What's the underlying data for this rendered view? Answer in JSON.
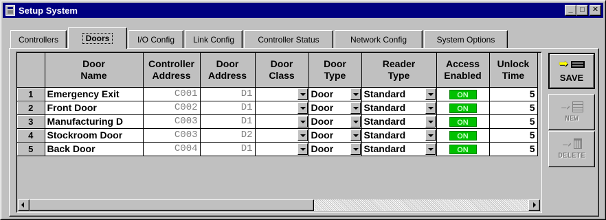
{
  "window": {
    "title": "Setup System"
  },
  "title_buttons": {
    "minimize": "_",
    "maximize": "□",
    "close": "✕"
  },
  "tabs": [
    {
      "label": "Controllers",
      "active": false
    },
    {
      "label": "Doors",
      "active": true
    },
    {
      "label": "I/O Config",
      "active": false
    },
    {
      "label": "Link Config",
      "active": false
    },
    {
      "label": "Controller Status",
      "active": false
    },
    {
      "label": "Network Config",
      "active": false
    },
    {
      "label": "System Options",
      "active": false
    }
  ],
  "grid": {
    "columns": [
      "",
      "Door\nName",
      "Controller\nAddress",
      "Door\nAddress",
      "Door\nClass",
      "Door\nType",
      "Reader\nType",
      "Access\nEnabled",
      "Unlock\nTime"
    ],
    "rows": [
      {
        "num": "1",
        "door_name": "Emergency Exit",
        "controller_address": "C001",
        "door_address": "D1",
        "door_class": "",
        "door_type": "Door",
        "reader_type": "Standard",
        "access_enabled": "ON",
        "unlock_time": "5"
      },
      {
        "num": "2",
        "door_name": "Front Door",
        "controller_address": "C002",
        "door_address": "D1",
        "door_class": "",
        "door_type": "Door",
        "reader_type": "Standard",
        "access_enabled": "ON",
        "unlock_time": "5"
      },
      {
        "num": "3",
        "door_name": "Manufacturing D",
        "controller_address": "C003",
        "door_address": "D1",
        "door_class": "",
        "door_type": "Door",
        "reader_type": "Standard",
        "access_enabled": "ON",
        "unlock_time": "5"
      },
      {
        "num": "4",
        "door_name": "Stockroom Door",
        "controller_address": "C003",
        "door_address": "D2",
        "door_class": "",
        "door_type": "Door",
        "reader_type": "Standard",
        "access_enabled": "ON",
        "unlock_time": "5"
      },
      {
        "num": "5",
        "door_name": "Back Door",
        "controller_address": "C004",
        "door_address": "D1",
        "door_class": "",
        "door_type": "Door",
        "reader_type": "Standard",
        "access_enabled": "ON",
        "unlock_time": "5"
      }
    ]
  },
  "buttons": {
    "save": "SAVE",
    "new": "NEW",
    "delete": "DELETE"
  },
  "colors": {
    "title_bar": "#000080",
    "on_badge": "#00c000",
    "save_arrow": "#ffff00"
  }
}
